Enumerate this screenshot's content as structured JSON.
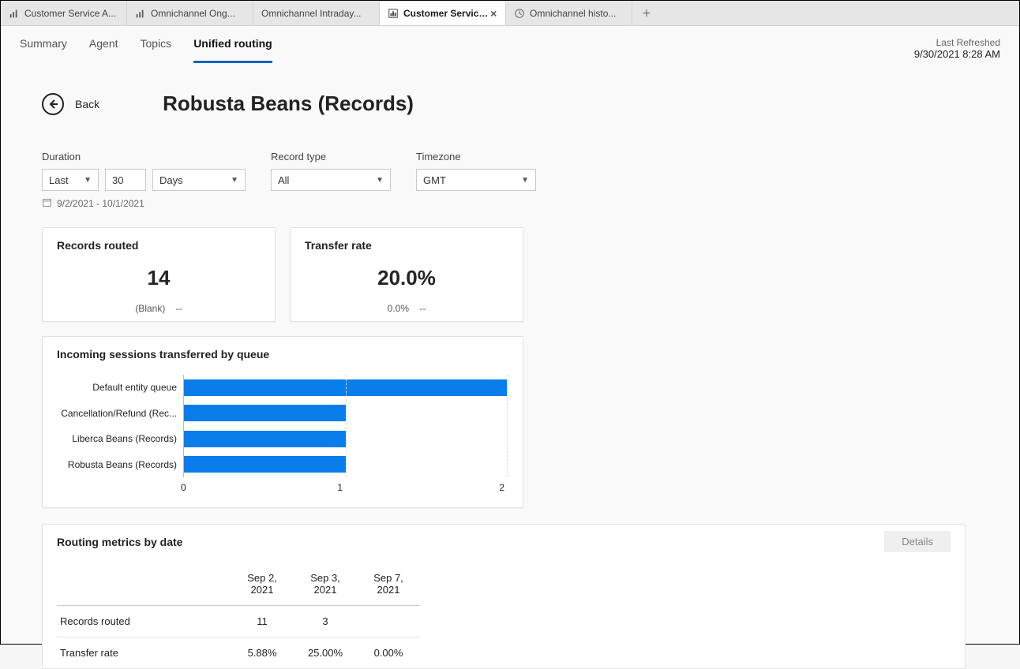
{
  "tabs": [
    {
      "label": "Customer Service A..."
    },
    {
      "label": "Omnichannel Ong..."
    },
    {
      "label": "Omnichannel Intraday..."
    },
    {
      "label": "Customer Service historic...",
      "active": true
    },
    {
      "label": "Omnichannel histo..."
    }
  ],
  "subnav": {
    "items": [
      "Summary",
      "Agent",
      "Topics",
      "Unified routing"
    ],
    "active": "Unified routing"
  },
  "refreshed": {
    "label": "Last Refreshed",
    "value": "9/30/2021 8:28 AM"
  },
  "back": {
    "label": "Back"
  },
  "title": "Robusta Beans (Records)",
  "filters": {
    "duration": {
      "label": "Duration",
      "mode": "Last",
      "count": "30",
      "unit": "Days",
      "range": "9/2/2021 - 10/1/2021"
    },
    "recordtype": {
      "label": "Record type",
      "value": "All"
    },
    "timezone": {
      "label": "Timezone",
      "value": "GMT"
    }
  },
  "kpi": {
    "records": {
      "title": "Records routed",
      "value": "14",
      "sub": "(Blank)",
      "dash": "--"
    },
    "transfer": {
      "title": "Transfer rate",
      "value": "20.0%",
      "sub": "0.0%",
      "dash": "--"
    }
  },
  "chart": {
    "title": "Incoming sessions transferred by queue"
  },
  "metrics": {
    "title": "Routing metrics by date",
    "details": "Details",
    "dates": [
      "Sep 2, 2021",
      "Sep 3, 2021",
      "Sep 7, 2021"
    ],
    "rows": [
      {
        "label": "Records routed",
        "cells": [
          "11",
          "3",
          ""
        ]
      },
      {
        "label": "Transfer rate",
        "cells": [
          "5.88%",
          "25.00%",
          "0.00%"
        ]
      }
    ]
  },
  "chart_data": {
    "type": "bar",
    "title": "Incoming sessions transferred by queue",
    "orientation": "horizontal",
    "xlabel": "",
    "ylabel": "",
    "xlim": [
      0,
      2
    ],
    "ticks": [
      0,
      1,
      2
    ],
    "categories": [
      "Default entity queue",
      "Cancellation/Refund (Rec...",
      "Liberca Beans (Records)",
      "Robusta Beans (Records)"
    ],
    "values": [
      2,
      1,
      1,
      1
    ]
  }
}
